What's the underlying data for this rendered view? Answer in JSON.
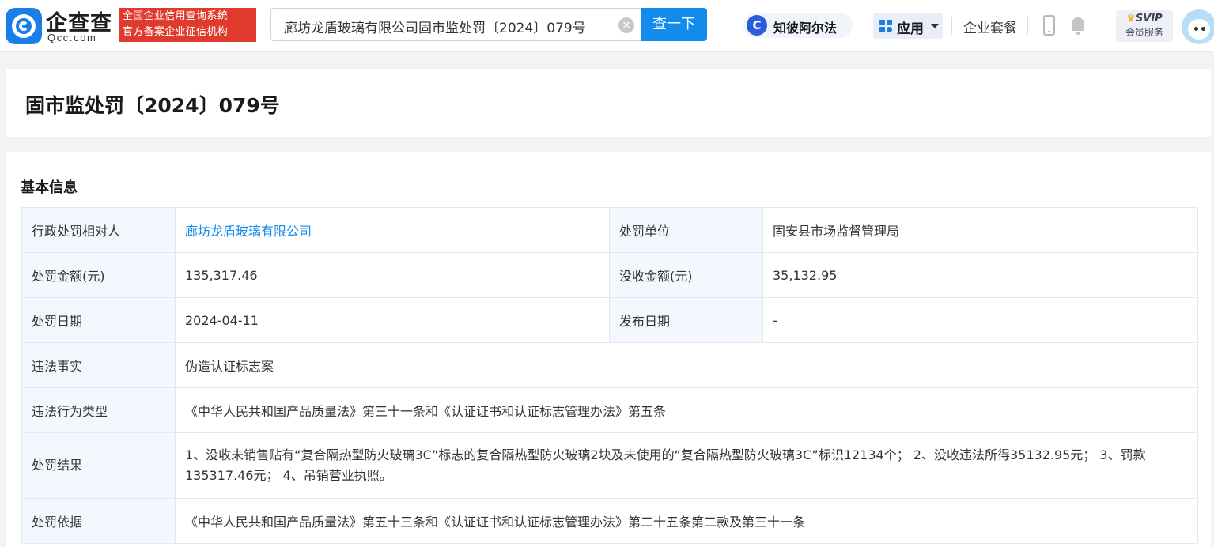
{
  "header": {
    "logo_text": "企查查",
    "logo_sub": "Qcc.com",
    "badge_line1": "全国企业信用查询系统",
    "badge_line2": "官方备案企业征信机构",
    "search_value": "廊坊龙盾玻璃有限公司固市监处罚〔2024〕079号",
    "search_button": "查一下",
    "zbaf_icon_letter": "C",
    "zbaf_label": "知彼阿尔法",
    "apps_label": "应用",
    "suite_label": "企业套餐",
    "svip_label": "SVIP",
    "svip_sub": "会员服务"
  },
  "page": {
    "title": "固市监处罚〔2024〕079号"
  },
  "basic_info": {
    "section_title": "基本信息",
    "rows": {
      "party_label": "行政处罚相对人",
      "party_value": "廊坊龙盾玻璃有限公司",
      "unit_label": "处罚单位",
      "unit_value": "固安县市场监督管理局",
      "amount_label": "处罚金额(元)",
      "amount_value": "135,317.46",
      "confiscated_label": "没收金额(元)",
      "confiscated_value": "35,132.95",
      "date_label": "处罚日期",
      "date_value": "2024-04-11",
      "publish_label": "发布日期",
      "publish_value": "-",
      "facts_label": "违法事实",
      "facts_value": "伪造认证标志案",
      "type_label": "违法行为类型",
      "type_value": "《中华人民共和国产品质量法》第三十一条和《认证证书和认证标志管理办法》第五条",
      "result_label": "处罚结果",
      "result_value": "1、没收未销售贴有“复合隔热型防火玻璃3C”标志的复合隔热型防火玻璃2块及未使用的“复合隔热型防火玻璃3C”标识12134个； 2、没收违法所得35132.95元； 3、罚款135317.46元； 4、吊销营业执照。",
      "basis_label": "处罚依据",
      "basis_value": "《中华人民共和国产品质量法》第五十三条和《认证证书和认证标志管理办法》第二十五条第二款及第三十一条"
    }
  },
  "colors": {
    "brand_blue": "#128bed",
    "badge_red": "#e03a2f",
    "label_bg": "#f2f8fd"
  }
}
